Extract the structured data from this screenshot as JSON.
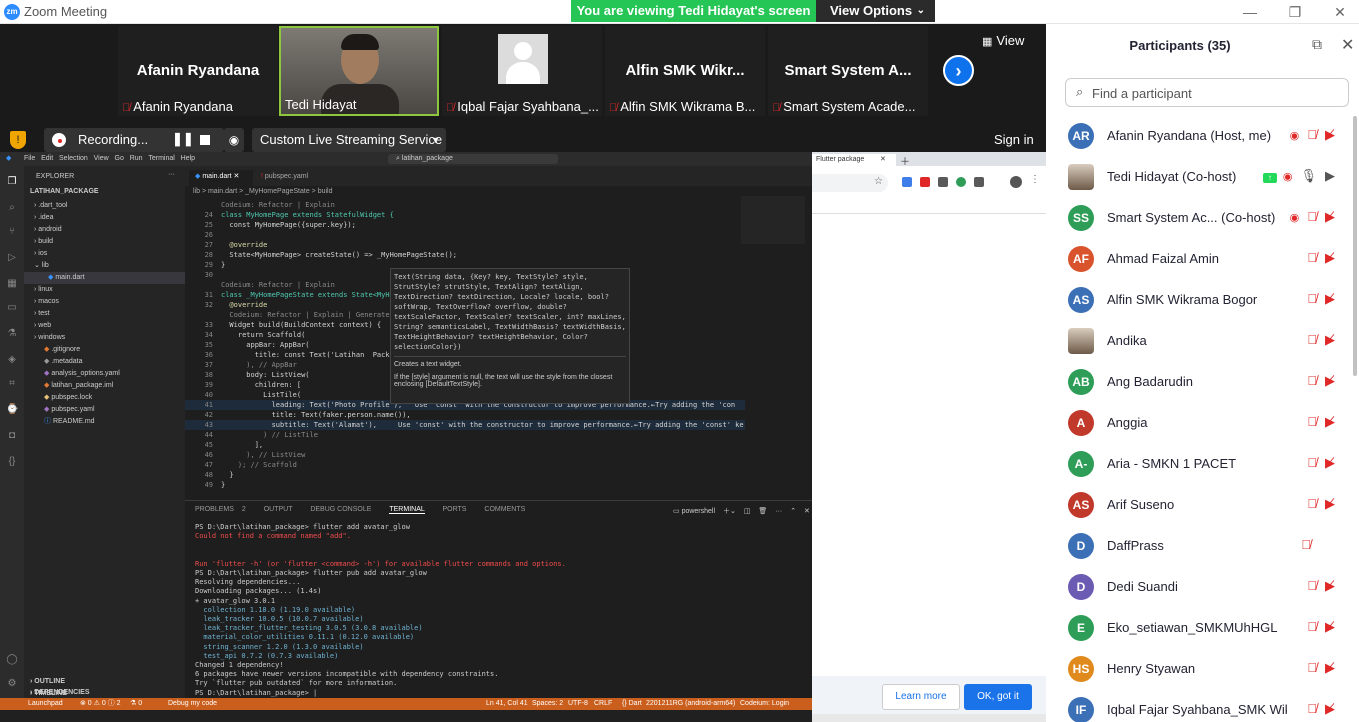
{
  "window": {
    "title": "Zoom Meeting",
    "app_icon": "zm"
  },
  "banner": {
    "message": "You are viewing Tedi Hidayat's screen",
    "options_label": "View Options"
  },
  "video_strip": {
    "view_label": "View",
    "tiles": [
      {
        "big_name": "Afanin Ryandana",
        "label": "Afanin Ryandana",
        "muted": true
      },
      {
        "big_name": "",
        "label": "Tedi Hidayat",
        "muted": false
      },
      {
        "big_name": "",
        "label": "Iqbal Fajar Syahbana_...",
        "muted": true
      },
      {
        "big_name": "Alfin SMK Wikr...",
        "label": "Alfin SMK Wikrama B...",
        "muted": true
      },
      {
        "big_name": "Smart System A...",
        "label": "Smart System Acade...",
        "muted": true
      }
    ]
  },
  "recording_bar": {
    "recording_label": "Recording...",
    "stream_label": "Custom Live Streaming Service",
    "sign_in_label": "Sign in"
  },
  "vscode": {
    "top_search": "latihan_package",
    "explorer_title": "EXPLORER",
    "project": "LATIHAN_PACKAGE",
    "tree": [
      ".dart_tool",
      ".idea",
      "android",
      "build",
      "ios",
      "lib",
      "main.dart",
      "linux",
      "macos",
      "test",
      "web",
      "windows",
      ".gitignore",
      ".metadata",
      "analysis_options.yaml",
      "latihan_package.iml",
      "pubspec.lock",
      "pubspec.yaml",
      "README.md"
    ],
    "bottom_sections": [
      "OUTLINE",
      "TIMELINE",
      "DEPENDENCIES"
    ],
    "tabs": [
      "main.dart",
      "pubspec.yaml"
    ],
    "breadcrumb": "lib > main.dart > _MyHomePageState > build",
    "code": [
      {
        "n": "",
        "t": "Codeium: Refactor | Explain"
      },
      {
        "n": "24",
        "t": "class MyHomePage extends StatefulWidget {"
      },
      {
        "n": "25",
        "t": "  const MyHomePage({super.key});"
      },
      {
        "n": "26",
        "t": ""
      },
      {
        "n": "27",
        "t": "  @override"
      },
      {
        "n": "28",
        "t": "  State<MyHomePage> createState() => _MyHomePageState();"
      },
      {
        "n": "29",
        "t": "}"
      },
      {
        "n": "30",
        "t": ""
      },
      {
        "n": "",
        "t": "Codeium: Refactor | Explain"
      },
      {
        "n": "31",
        "t": "class _MyHomePageState extends State<MyH"
      },
      {
        "n": "32",
        "t": "  @override"
      },
      {
        "n": "",
        "t": "  Codeium: Refactor | Explain | Generate Function Comment"
      },
      {
        "n": "33",
        "t": "  Widget build(BuildContext context) {"
      },
      {
        "n": "34",
        "t": "    return Scaffold("
      },
      {
        "n": "35",
        "t": "      appBar: AppBar("
      },
      {
        "n": "36",
        "t": "        title: const Text('Latihan  Pack"
      },
      {
        "n": "37",
        "t": "      ), // AppBar"
      },
      {
        "n": "38",
        "t": "      body: ListView("
      },
      {
        "n": "39",
        "t": "        children: ["
      },
      {
        "n": "40",
        "t": "          ListTile("
      },
      {
        "n": "41",
        "t": "            leading: Text('Photo Profile'),   Use 'const' with the constructor to improve performance.←Try adding the 'con"
      },
      {
        "n": "42",
        "t": "            title: Text(faker.person.name()),"
      },
      {
        "n": "43",
        "t": "            subtitle: Text('Alamat'),     Use 'const' with the constructor to improve performance.←Try adding the 'const' ke"
      },
      {
        "n": "44",
        "t": "          ) // ListTile"
      },
      {
        "n": "45",
        "t": "        ],"
      },
      {
        "n": "46",
        "t": "      ), // ListView"
      },
      {
        "n": "47",
        "t": "    ); // Scaffold"
      },
      {
        "n": "48",
        "t": "  }"
      },
      {
        "n": "49",
        "t": "}"
      }
    ],
    "hover": {
      "signature": "Text(String data, {Key? key, TextStyle? style, StrutStyle? strutStyle, TextAlign? textAlign, TextDirection? textDirection, Locale? locale, bool? softWrap, TextOverflow? overflow, double? textScaleFactor, TextScaler? textScaler, int? maxLines, String? semanticsLabel, TextWidthBasis? textWidthBasis, TextHeightBehavior? textHeightBehavior, Color? selectionColor})",
      "desc1": "Creates a text widget.",
      "desc2": "If the [style] argument is null, the text will use the style from the closest enclosing [DefaultTextStyle]."
    },
    "panel_tabs": [
      "PROBLEMS",
      "2",
      "OUTPUT",
      "DEBUG CONSOLE",
      "TERMINAL",
      "PORTS",
      "COMMENTS"
    ],
    "terminal_shell": "powershell",
    "terminal": [
      "PS D:\\Dart\\latihan_package> flutter add avatar_glow",
      "Could not find a command named \"add\".",
      "",
      "",
      "Run 'flutter -h' (or 'flutter <command> -h') for available flutter commands and options.",
      "PS D:\\Dart\\latihan_package> flutter pub add avatar_glow",
      "Resolving dependencies...",
      "Downloading packages... (1.4s)",
      "+ avatar_glow 3.0.1",
      "  collection 1.18.0 (1.19.0 available)",
      "  leak_tracker 10.0.5 (10.0.7 available)",
      "  leak_tracker_flutter_testing 3.0.5 (3.0.8 available)",
      "  material_color_utilities 0.11.1 (0.12.0 available)",
      "  string_scanner 1.2.0 (1.3.0 available)",
      "  test_api 0.7.2 (0.7.3 available)",
      "Changed 1 dependency!",
      "6 packages have newer versions incompatible with dependency constraints.",
      "Try `flutter pub outdated` for more information.",
      "PS D:\\Dart\\latihan_package> |"
    ],
    "status_left": [
      "Launchpad",
      "⊗ 0 ⚠ 0 ⓘ 2",
      "⚗ 0",
      "Debug my code"
    ],
    "status_right": [
      "Ln 41, Col 41",
      "Spaces: 2",
      "UTF-8",
      "CRLF",
      "{} Dart",
      "2201211RG (android-arm64)",
      "Codeium: Login"
    ]
  },
  "chrome": {
    "tab_label": "Flutter package",
    "learn_more": "Learn more",
    "ok_got_it": "OK, got it"
  },
  "participants": {
    "title": "Participants (35)",
    "search_placeholder": "Find a participant",
    "list": [
      {
        "initials": "AR",
        "name": "Afanin Ryandana (Host, me)",
        "color": "#3b6fb6",
        "photo": false,
        "rec": true,
        "mic": "off",
        "cam": "off",
        "share": false
      },
      {
        "initials": "",
        "name": "Tedi Hidayat (Co-host)",
        "color": "#c9b8a3",
        "photo": true,
        "rec": true,
        "mic": "on",
        "cam": "on",
        "share": true
      },
      {
        "initials": "SS",
        "name": "Smart System Ac... (Co-host)",
        "color": "#2e9d57",
        "photo": false,
        "rec": true,
        "mic": "off",
        "cam": "off",
        "share": false
      },
      {
        "initials": "AF",
        "name": "Ahmad Faizal Amin",
        "color": "#d9532c",
        "photo": false,
        "rec": false,
        "mic": "off",
        "cam": "off",
        "share": false
      },
      {
        "initials": "AS",
        "name": "Alfin SMK Wikrama Bogor",
        "color": "#3b6fb6",
        "photo": false,
        "rec": false,
        "mic": "off",
        "cam": "off",
        "share": false
      },
      {
        "initials": "",
        "name": "Andika",
        "color": "#c9b8a3",
        "photo": true,
        "rec": false,
        "mic": "off",
        "cam": "off",
        "share": false
      },
      {
        "initials": "AB",
        "name": "Ang Badarudin",
        "color": "#2e9d57",
        "photo": false,
        "rec": false,
        "mic": "off",
        "cam": "off",
        "share": false
      },
      {
        "initials": "A",
        "name": "Anggia",
        "color": "#c0392b",
        "photo": false,
        "rec": false,
        "mic": "off",
        "cam": "off",
        "share": false
      },
      {
        "initials": "A-",
        "name": "Aria - SMKN 1 PACET",
        "color": "#2e9d57",
        "photo": false,
        "rec": false,
        "mic": "off",
        "cam": "off",
        "share": false
      },
      {
        "initials": "AS",
        "name": "Arif Suseno",
        "color": "#c0392b",
        "photo": false,
        "rec": false,
        "mic": "off",
        "cam": "off",
        "share": false
      },
      {
        "initials": "D",
        "name": "DaffPrass",
        "color": "#3b6fb6",
        "photo": false,
        "rec": false,
        "mic": "off",
        "cam": "none",
        "share": false
      },
      {
        "initials": "D",
        "name": "Dedi Suandi",
        "color": "#6c5bb3",
        "photo": false,
        "rec": false,
        "mic": "off",
        "cam": "off",
        "share": false
      },
      {
        "initials": "E",
        "name": "Eko_setiawan_SMKMUhHGL",
        "color": "#2e9d57",
        "photo": false,
        "rec": false,
        "mic": "off",
        "cam": "off",
        "share": false
      },
      {
        "initials": "HS",
        "name": "Henry Styawan",
        "color": "#e08a1e",
        "photo": false,
        "rec": false,
        "mic": "off",
        "cam": "off",
        "share": false
      },
      {
        "initials": "IF",
        "name": "Iqbal Fajar Syahbana_SMK Wik...",
        "color": "#3b6fb6",
        "photo": false,
        "rec": false,
        "mic": "off",
        "cam": "off",
        "share": false
      }
    ]
  }
}
